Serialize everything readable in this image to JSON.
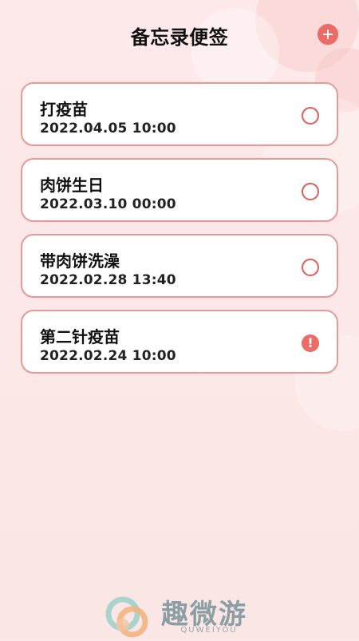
{
  "header": {
    "title": "备忘录便签",
    "add_icon": "plus-icon",
    "accent_color": "#ec6b66"
  },
  "memos": [
    {
      "title": "打疫苗",
      "datetime": "2022.04.05 10:00",
      "status_icon": "empty-circle-icon"
    },
    {
      "title": "肉饼生日",
      "datetime": "2022.03.10 00:00",
      "status_icon": "empty-circle-icon"
    },
    {
      "title": "带肉饼洗澡",
      "datetime": "2022.02.28 13:40",
      "status_icon": "empty-circle-icon"
    },
    {
      "title": "第二针疫苗",
      "datetime": "2022.02.24 10:00",
      "status_icon": "exclamation-icon"
    }
  ],
  "watermark": {
    "name": "趣微游",
    "subtitle": "QUWEIYOU"
  },
  "colors": {
    "background": "#fbe9e9",
    "card_border": "#e59a97",
    "card_background": "#ffffff",
    "accent": "#ec6b66"
  }
}
